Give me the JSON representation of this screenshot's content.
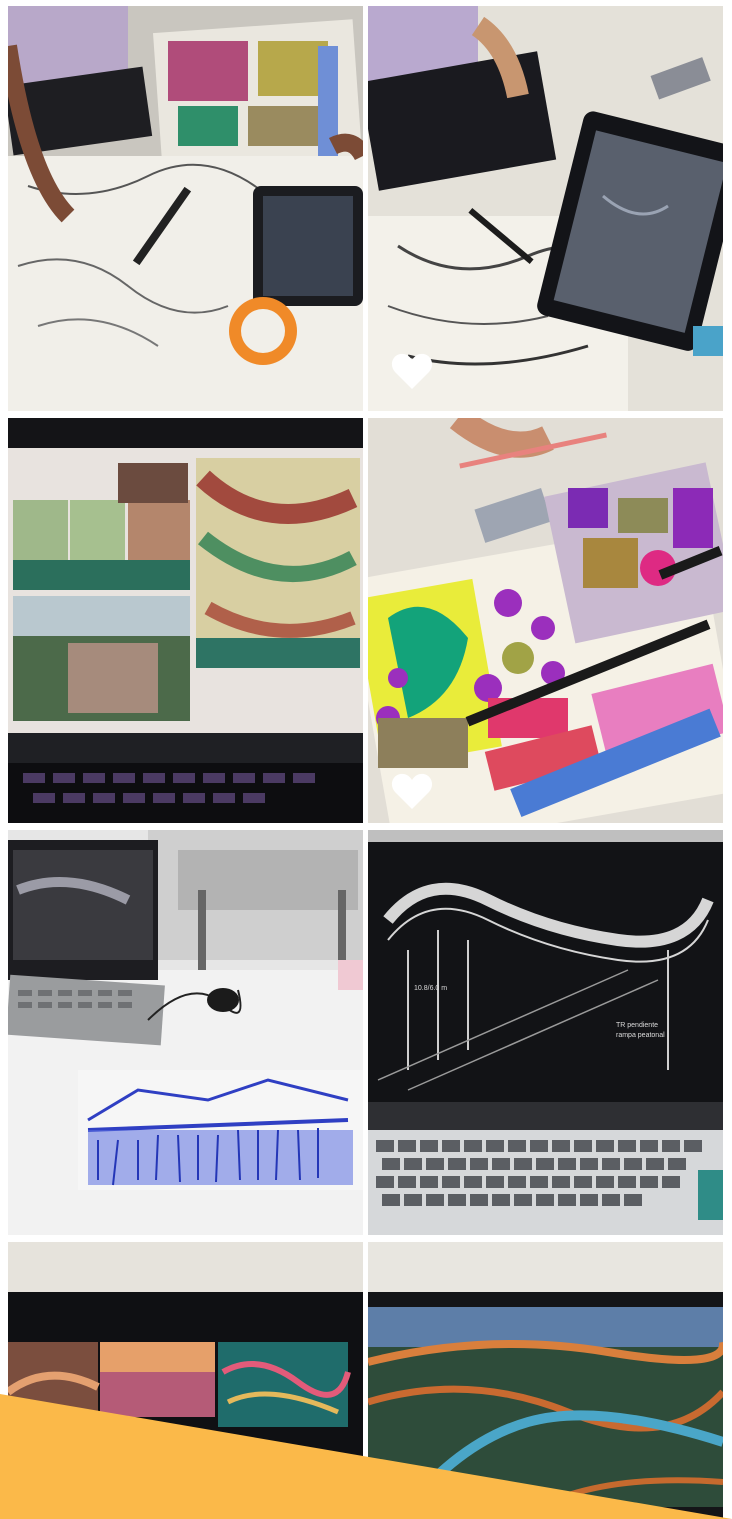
{
  "gallery": {
    "tiles": [
      {
        "name": "tile-sketch-table-tape",
        "liked": false
      },
      {
        "name": "tile-sketch-tablet",
        "liked": true
      },
      {
        "name": "tile-laptop-presentation-board",
        "liked": false
      },
      {
        "name": "tile-colored-site-plan",
        "liked": true
      },
      {
        "name": "tile-laptop-blue-sketch",
        "liked": false
      },
      {
        "name": "tile-laptop-walkway-drawing",
        "liked": false
      },
      {
        "name": "tile-laptop-sunset-renders",
        "liked": false
      },
      {
        "name": "tile-laptop-aerial-render",
        "liked": false
      }
    ],
    "walkway_caption_measure": "10.8/6.0 m",
    "walkway_caption_note_1": "TR pendiente",
    "walkway_caption_note_2": "rampa peatonal"
  },
  "colors": {
    "accent_banner": "#fbb949",
    "heart": "#ffffff"
  },
  "icons": {
    "like": "heart-icon"
  }
}
